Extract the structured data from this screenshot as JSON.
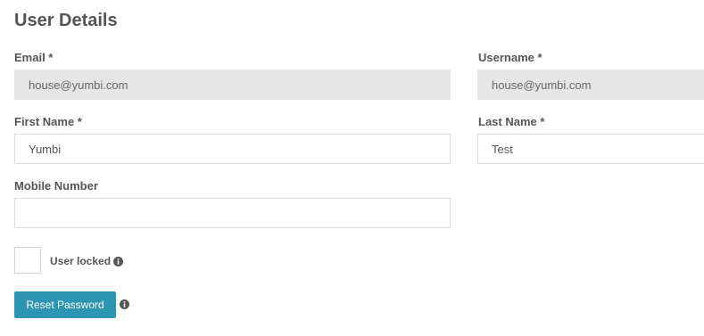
{
  "section": {
    "title": "User Details"
  },
  "fields": {
    "email": {
      "label": "Email *",
      "value": "house@yumbi.com"
    },
    "username": {
      "label": "Username *",
      "value": "house@yumbi.com"
    },
    "first_name": {
      "label": "First Name *",
      "value": "Yumbi"
    },
    "last_name": {
      "label": "Last Name *",
      "value": "Test"
    },
    "mobile": {
      "label": "Mobile Number",
      "value": ""
    }
  },
  "user_locked": {
    "label": "User locked",
    "checked": false,
    "icon": "info-icon"
  },
  "actions": {
    "reset_password_label": "Reset Password",
    "reset_info_icon": "info-icon"
  },
  "colors": {
    "accent": "#2b95b2",
    "readonly_bg": "#e6e6e6",
    "text": "#555555"
  }
}
